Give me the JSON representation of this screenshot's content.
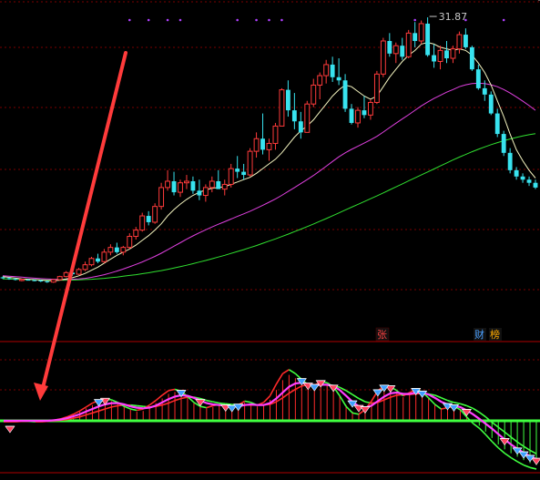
{
  "colors": {
    "background": "#000000",
    "grid": "#7a0000",
    "up_candle": "#ff3b3b",
    "down_candle": "#38e3ef",
    "ma_short": "#f5f5c0",
    "ma_mid": "#e040e0",
    "ma_long": "#30e030",
    "arrow": "#ff3b3b",
    "osc_up": "#ff2a2a",
    "osc_down": "#40ff40",
    "osc_mid": "#ff40ff",
    "badge_zhang": "#ff4040",
    "badge_cai": "#4aa0ff",
    "badge_bang": "#ffaa00",
    "peak_label": "#c8c8c8",
    "marker_dot": "#b040ff"
  },
  "icons": {
    "buy_gem": "gem-icon-red",
    "sell_gem": "gem-icon-blue"
  },
  "chart_data": [
    {
      "type": "candlestick",
      "title": "",
      "price_ylim": [
        11.5,
        33.0
      ],
      "annotations": [
        {
          "text": "31.87",
          "bar_index": 67
        }
      ],
      "candles": [
        [
          15.4,
          15.45,
          15.3,
          15.35
        ],
        [
          15.35,
          15.4,
          15.25,
          15.3
        ],
        [
          15.3,
          15.35,
          15.2,
          15.25
        ],
        [
          15.2,
          15.3,
          15.15,
          15.28
        ],
        [
          15.25,
          15.3,
          15.2,
          15.22
        ],
        [
          15.22,
          15.28,
          15.15,
          15.2
        ],
        [
          15.2,
          15.25,
          15.1,
          15.15
        ],
        [
          15.15,
          15.2,
          15.05,
          15.1
        ],
        [
          15.1,
          15.3,
          15.05,
          15.25
        ],
        [
          15.25,
          15.5,
          15.2,
          15.45
        ],
        [
          15.45,
          15.8,
          15.4,
          15.7
        ],
        [
          15.7,
          15.9,
          15.5,
          15.6
        ],
        [
          15.6,
          16.0,
          15.55,
          15.9
        ],
        [
          15.9,
          16.4,
          15.8,
          16.2
        ],
        [
          16.2,
          16.7,
          16.1,
          16.6
        ],
        [
          16.6,
          16.9,
          16.3,
          16.4
        ],
        [
          16.4,
          17.2,
          16.3,
          17.0
        ],
        [
          17.0,
          17.5,
          16.8,
          17.3
        ],
        [
          17.3,
          17.6,
          16.9,
          17.0
        ],
        [
          17.0,
          17.4,
          16.8,
          17.3
        ],
        [
          17.3,
          18.2,
          17.2,
          18.0
        ],
        [
          18.0,
          18.6,
          17.8,
          18.4
        ],
        [
          18.4,
          19.5,
          18.3,
          19.3
        ],
        [
          19.3,
          19.6,
          18.7,
          18.9
        ],
        [
          18.9,
          20.1,
          18.8,
          19.9
        ],
        [
          19.9,
          21.4,
          19.7,
          21.1
        ],
        [
          21.1,
          22.2,
          20.9,
          21.5
        ],
        [
          21.5,
          22.1,
          20.6,
          20.8
        ],
        [
          20.8,
          21.6,
          20.5,
          21.4
        ],
        [
          21.4,
          21.9,
          21.0,
          21.5
        ],
        [
          21.5,
          21.8,
          20.7,
          20.9
        ],
        [
          20.9,
          21.6,
          20.3,
          20.6
        ],
        [
          20.6,
          21.3,
          20.2,
          21.1
        ],
        [
          21.1,
          21.8,
          20.8,
          21.5
        ],
        [
          21.5,
          22.2,
          21.1,
          21.0
        ],
        [
          21.0,
          21.6,
          20.6,
          21.3
        ],
        [
          21.3,
          22.6,
          21.1,
          22.3
        ],
        [
          22.3,
          23.1,
          21.7,
          22.1
        ],
        [
          22.1,
          22.6,
          21.6,
          21.9
        ],
        [
          21.9,
          23.6,
          21.8,
          23.4
        ],
        [
          23.4,
          24.6,
          23.0,
          24.2
        ],
        [
          24.2,
          25.8,
          23.2,
          23.5
        ],
        [
          23.5,
          24.2,
          22.8,
          23.9
        ],
        [
          23.9,
          25.2,
          23.5,
          25.0
        ],
        [
          25.0,
          27.4,
          25.0,
          27.3
        ],
        [
          27.3,
          27.9,
          25.6,
          26.0
        ],
        [
          26.0,
          27.1,
          24.8,
          25.3
        ],
        [
          25.3,
          25.9,
          24.2,
          24.6
        ],
        [
          24.6,
          26.6,
          24.6,
          26.4
        ],
        [
          26.4,
          28.0,
          26.2,
          27.6
        ],
        [
          27.6,
          28.4,
          26.7,
          28.2
        ],
        [
          28.2,
          29.2,
          27.7,
          28.9
        ],
        [
          28.9,
          29.4,
          27.8,
          28.1
        ],
        [
          28.1,
          29.3,
          27.6,
          27.9
        ],
        [
          27.9,
          28.3,
          25.9,
          26.1
        ],
        [
          26.1,
          26.4,
          25.1,
          25.2
        ],
        [
          25.2,
          26.2,
          24.9,
          26.0
        ],
        [
          26.0,
          26.9,
          25.5,
          25.7
        ],
        [
          25.7,
          26.7,
          25.4,
          26.5
        ],
        [
          26.5,
          28.5,
          26.4,
          28.3
        ],
        [
          28.3,
          30.6,
          28.1,
          30.4
        ],
        [
          30.4,
          30.9,
          29.4,
          29.6
        ],
        [
          29.6,
          30.3,
          29.0,
          30.1
        ],
        [
          30.1,
          30.6,
          29.2,
          29.4
        ],
        [
          29.4,
          31.1,
          29.3,
          30.9
        ],
        [
          30.9,
          31.6,
          30.0,
          30.4
        ],
        [
          30.4,
          31.7,
          30.2,
          31.5
        ],
        [
          31.5,
          31.9,
          29.4,
          29.5
        ],
        [
          29.5,
          30.2,
          28.7,
          29.1
        ],
        [
          29.1,
          30.1,
          28.6,
          29.8
        ],
        [
          29.8,
          30.4,
          29.0,
          29.3
        ],
        [
          29.3,
          30.1,
          29.0,
          29.9
        ],
        [
          29.9,
          31.0,
          29.6,
          30.8
        ],
        [
          30.8,
          31.2,
          29.9,
          30.0
        ],
        [
          30.0,
          30.1,
          28.5,
          28.6
        ],
        [
          28.6,
          28.9,
          27.3,
          27.4
        ],
        [
          27.4,
          27.9,
          26.6,
          27.0
        ],
        [
          27.0,
          27.2,
          25.7,
          25.8
        ],
        [
          25.8,
          26.1,
          24.3,
          24.5
        ],
        [
          24.5,
          24.7,
          23.1,
          23.3
        ],
        [
          23.3,
          23.6,
          22.0,
          22.2
        ],
        [
          22.2,
          22.4,
          21.6,
          21.8
        ],
        [
          21.8,
          22.0,
          21.4,
          21.6
        ],
        [
          21.6,
          21.8,
          21.2,
          21.4
        ],
        [
          21.4,
          21.6,
          21.0,
          21.1
        ]
      ],
      "ma_short": [
        15.45,
        15.4,
        15.35,
        15.3,
        15.28,
        15.26,
        15.23,
        15.2,
        15.19,
        15.22,
        15.3,
        15.38,
        15.5,
        15.65,
        15.85,
        16.05,
        16.3,
        16.55,
        16.8,
        17.0,
        17.2,
        17.45,
        17.75,
        18.05,
        18.4,
        18.8,
        19.3,
        19.7,
        20.05,
        20.35,
        20.6,
        20.8,
        20.95,
        21.05,
        21.1,
        21.15,
        21.3,
        21.45,
        21.6,
        21.75,
        22.0,
        22.3,
        22.6,
        22.9,
        23.3,
        23.8,
        24.3,
        24.7,
        25.0,
        25.4,
        25.9,
        26.4,
        26.9,
        27.3,
        27.6,
        27.5,
        27.2,
        26.9,
        26.7,
        26.9,
        27.5,
        28.1,
        28.6,
        29.1,
        29.5,
        29.8,
        30.2,
        30.3,
        30.2,
        30.0,
        29.9,
        29.8,
        29.9,
        29.8,
        29.5,
        29.0,
        28.4,
        27.6,
        26.6,
        25.6,
        24.5,
        23.5,
        22.8,
        22.2,
        21.7
      ],
      "ma_mid": [
        15.5,
        15.47,
        15.44,
        15.41,
        15.38,
        15.35,
        15.32,
        15.3,
        15.28,
        15.27,
        15.27,
        15.28,
        15.3,
        15.34,
        15.4,
        15.48,
        15.57,
        15.68,
        15.8,
        15.93,
        16.07,
        16.22,
        16.38,
        16.55,
        16.73,
        16.93,
        17.15,
        17.38,
        17.6,
        17.82,
        18.03,
        18.23,
        18.42,
        18.6,
        18.77,
        18.93,
        19.1,
        19.27,
        19.43,
        19.6,
        19.78,
        19.97,
        20.17,
        20.38,
        20.6,
        20.85,
        21.1,
        21.35,
        21.6,
        21.87,
        22.15,
        22.45,
        22.75,
        23.05,
        23.3,
        23.52,
        23.72,
        23.92,
        24.12,
        24.35,
        24.62,
        24.9,
        25.18,
        25.45,
        25.72,
        26.0,
        26.28,
        26.52,
        26.75,
        26.95,
        27.15,
        27.32,
        27.5,
        27.62,
        27.7,
        27.72,
        27.7,
        27.62,
        27.5,
        27.32,
        27.1,
        26.85,
        26.58,
        26.3,
        26.0
      ],
      "ma_long": [
        15.3,
        15.29,
        15.28,
        15.27,
        15.26,
        15.25,
        15.24,
        15.23,
        15.22,
        15.22,
        15.22,
        15.23,
        15.24,
        15.26,
        15.28,
        15.31,
        15.34,
        15.38,
        15.42,
        15.47,
        15.52,
        15.57,
        15.63,
        15.69,
        15.76,
        15.83,
        15.91,
        15.99,
        16.08,
        16.17,
        16.27,
        16.37,
        16.47,
        16.58,
        16.69,
        16.8,
        16.92,
        17.04,
        17.16,
        17.29,
        17.42,
        17.56,
        17.7,
        17.84,
        17.99,
        18.14,
        18.3,
        18.46,
        18.62,
        18.79,
        18.96,
        19.13,
        19.31,
        19.49,
        19.67,
        19.85,
        20.03,
        20.21,
        20.39,
        20.57,
        20.76,
        20.95,
        21.14,
        21.33,
        21.52,
        21.71,
        21.9,
        22.09,
        22.28,
        22.47,
        22.66,
        22.85,
        23.03,
        23.2,
        23.37,
        23.53,
        23.68,
        23.82,
        23.95,
        24.07,
        24.18,
        24.28,
        24.37,
        24.45,
        24.52
      ]
    },
    {
      "type": "bar",
      "title": "",
      "ylim": [
        -1.0,
        1.0
      ],
      "histogram": [
        0.0,
        0.0,
        0.0,
        0.0,
        0.0,
        0.0,
        0.0,
        0.01,
        0.02,
        0.04,
        0.07,
        0.1,
        0.14,
        0.19,
        0.24,
        0.28,
        0.3,
        0.3,
        0.27,
        0.22,
        0.17,
        0.14,
        0.15,
        0.2,
        0.27,
        0.34,
        0.41,
        0.44,
        0.42,
        0.35,
        0.27,
        0.21,
        0.19,
        0.21,
        0.23,
        0.21,
        0.19,
        0.22,
        0.28,
        0.26,
        0.22,
        0.25,
        0.32,
        0.47,
        0.62,
        0.7,
        0.65,
        0.58,
        0.52,
        0.52,
        0.57,
        0.55,
        0.5,
        0.38,
        0.24,
        0.14,
        0.11,
        0.16,
        0.28,
        0.42,
        0.5,
        0.49,
        0.44,
        0.36,
        0.4,
        0.45,
        0.42,
        0.34,
        0.25,
        0.19,
        0.21,
        0.23,
        0.18,
        0.08,
        -0.02,
        -0.1,
        -0.22,
        -0.35,
        -0.48,
        -0.58,
        -0.66,
        -0.73,
        -0.8,
        -0.86,
        -0.9
      ],
      "line_up": [
        -0.02,
        -0.02,
        -0.02,
        -0.01,
        -0.01,
        -0.02,
        -0.02,
        -0.01,
        0.01,
        0.03,
        0.06,
        0.1,
        0.15,
        0.21,
        0.27,
        0.31,
        0.33,
        0.32,
        0.28,
        0.22,
        0.18,
        0.16,
        0.18,
        0.24,
        0.31,
        0.39,
        0.46,
        0.48,
        0.45,
        0.37,
        0.28,
        0.22,
        0.2,
        0.23,
        0.25,
        0.23,
        0.21,
        0.24,
        0.3,
        0.28,
        0.24,
        0.28,
        0.38,
        0.56,
        0.72,
        0.78,
        0.72,
        0.63,
        0.55,
        0.54,
        0.6,
        0.58,
        0.52,
        0.38,
        0.22,
        0.12,
        0.1,
        0.17,
        0.3,
        0.46,
        0.53,
        0.52,
        0.46,
        0.38,
        0.43,
        0.48,
        0.44,
        0.35,
        0.25,
        0.18,
        0.2,
        0.22,
        0.17,
        0.06,
        -0.05,
        -0.15,
        -0.28,
        -0.42,
        -0.55,
        -0.66,
        -0.75,
        -0.83,
        -0.9,
        -0.95,
        -0.98
      ],
      "line_mid": [
        0.0,
        0.0,
        0.0,
        0.0,
        0.0,
        0.0,
        0.0,
        0.0,
        0.01,
        0.02,
        0.04,
        0.07,
        0.1,
        0.14,
        0.18,
        0.22,
        0.25,
        0.27,
        0.27,
        0.25,
        0.22,
        0.2,
        0.19,
        0.2,
        0.23,
        0.28,
        0.33,
        0.37,
        0.39,
        0.38,
        0.35,
        0.31,
        0.27,
        0.25,
        0.24,
        0.23,
        0.22,
        0.22,
        0.24,
        0.25,
        0.24,
        0.24,
        0.27,
        0.34,
        0.43,
        0.52,
        0.57,
        0.58,
        0.56,
        0.54,
        0.55,
        0.55,
        0.53,
        0.47,
        0.38,
        0.29,
        0.22,
        0.2,
        0.23,
        0.3,
        0.37,
        0.42,
        0.43,
        0.41,
        0.41,
        0.43,
        0.43,
        0.4,
        0.35,
        0.29,
        0.25,
        0.23,
        0.21,
        0.16,
        0.1,
        0.03,
        -0.06,
        -0.16,
        -0.27,
        -0.38,
        -0.48,
        -0.57,
        -0.65,
        -0.72,
        -0.78
      ],
      "line_dn": [
        0.0,
        0.0,
        0.0,
        0.0,
        0.0,
        0.0,
        0.0,
        0.0,
        0.0,
        0.01,
        0.02,
        0.04,
        0.06,
        0.09,
        0.12,
        0.15,
        0.18,
        0.21,
        0.23,
        0.24,
        0.24,
        0.23,
        0.22,
        0.21,
        0.22,
        0.24,
        0.27,
        0.31,
        0.34,
        0.36,
        0.36,
        0.34,
        0.31,
        0.29,
        0.27,
        0.26,
        0.25,
        0.24,
        0.24,
        0.24,
        0.24,
        0.24,
        0.25,
        0.29,
        0.35,
        0.42,
        0.48,
        0.53,
        0.55,
        0.55,
        0.55,
        0.55,
        0.54,
        0.51,
        0.46,
        0.4,
        0.34,
        0.29,
        0.27,
        0.28,
        0.32,
        0.36,
        0.39,
        0.4,
        0.4,
        0.41,
        0.42,
        0.41,
        0.39,
        0.35,
        0.31,
        0.28,
        0.26,
        0.23,
        0.19,
        0.13,
        0.06,
        -0.03,
        -0.13,
        -0.23,
        -0.33,
        -0.43,
        -0.52,
        -0.6,
        -0.67
      ],
      "gems_red": [
        1,
        16,
        31,
        35,
        48,
        50,
        52,
        56,
        57,
        61,
        73,
        79,
        84,
        85
      ],
      "gems_blue": [
        15,
        28,
        36,
        37,
        47,
        49,
        55,
        59,
        60,
        65,
        66,
        70,
        71,
        81,
        82,
        83
      ]
    }
  ],
  "badges": {
    "zhang": "张",
    "cai": "财",
    "bang": "榜"
  },
  "dots": [
    {
      "bar_index": 20
    },
    {
      "bar_index": 23
    },
    {
      "bar_index": 26
    },
    {
      "bar_index": 28
    },
    {
      "bar_index": 37
    },
    {
      "bar_index": 40
    },
    {
      "bar_index": 42
    },
    {
      "bar_index": 44
    },
    {
      "bar_index": 65
    },
    {
      "bar_index": 73
    },
    {
      "bar_index": 79
    }
  ]
}
